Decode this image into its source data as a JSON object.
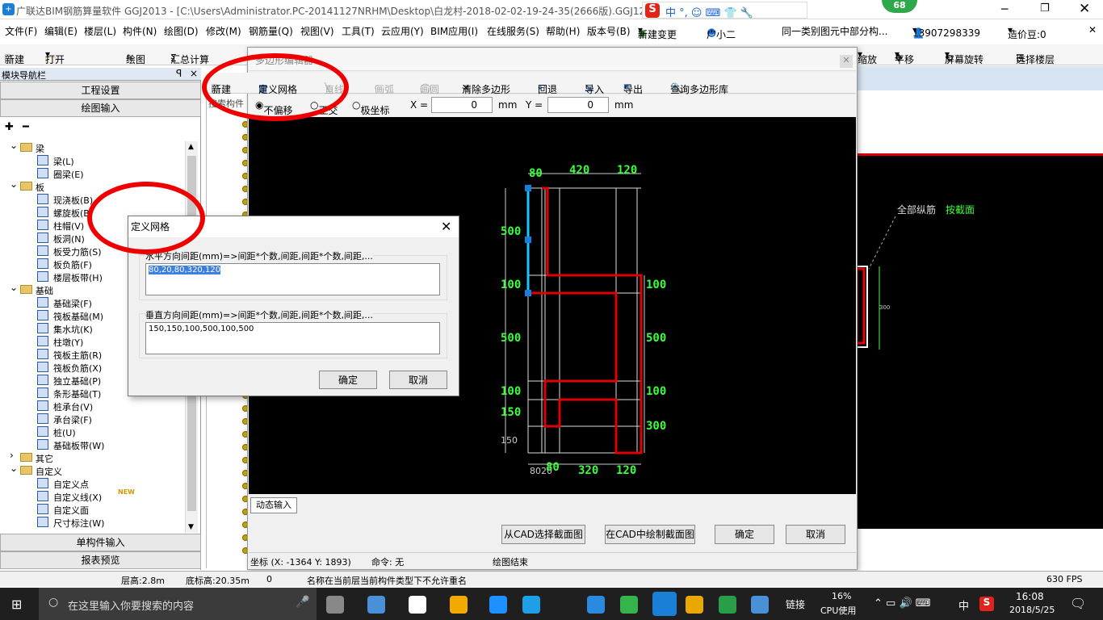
{
  "titlebar": {
    "title": "广联达BIM钢筋算量软件 GGJ2013 - [C:\\Users\\Administrator.PC-20141127NRHM\\Desktop\\白龙村-2018-02-02-19-24-35(2666版).GGJ12]",
    "badge": "68"
  },
  "menu": {
    "file": "文件(F)",
    "edit": "编辑(E)",
    "floor": "楼层(L)",
    "component": "构件(N)",
    "draw": "绘图(D)",
    "modify": "修改(M)",
    "rebar": "钢筋量(Q)",
    "view": "视图(V)",
    "tools": "工具(T)",
    "cloud": "云应用(Y)",
    "bim": "BIM应用(I)",
    "online": "在线服务(S)",
    "help": "帮助(H)",
    "version": "版本号(B)",
    "newchange": "新建变更",
    "xiaoer": "广小二",
    "notice": "同一类别图元中部分构...",
    "phone": "13907298339",
    "beans": "造价豆:0"
  },
  "toolbar": {
    "new": "新建",
    "open": "打开",
    "draw": "绘图",
    "sum": "汇总计算",
    "zoom": "缩放",
    "pan": "平移",
    "rotate": "屏幕旋转",
    "selfloor": "选择楼层"
  },
  "left": {
    "header": "模块导航栏",
    "pin": "ꟼ",
    "close": "×",
    "engsetup": "工程设置",
    "drawinput": "绘图输入",
    "single": "单构件输入",
    "report": "报表预览",
    "tree": [
      {
        "label": "梁",
        "type": "folder"
      },
      {
        "label": "梁(L)",
        "type": "item"
      },
      {
        "label": "圈梁(E)",
        "type": "item"
      },
      {
        "label": "板",
        "type": "folder"
      },
      {
        "label": "现浇板(B)",
        "type": "item"
      },
      {
        "label": "螺旋板(B)",
        "type": "item"
      },
      {
        "label": "柱帽(V)",
        "type": "item"
      },
      {
        "label": "板洞(N)",
        "type": "item"
      },
      {
        "label": "板受力筋(S)",
        "type": "item"
      },
      {
        "label": "板负筋(F)",
        "type": "item"
      },
      {
        "label": "楼层板带(H)",
        "type": "item"
      },
      {
        "label": "基础",
        "type": "folder"
      },
      {
        "label": "基础梁(F)",
        "type": "item"
      },
      {
        "label": "筏板基础(M)",
        "type": "item"
      },
      {
        "label": "集水坑(K)",
        "type": "item"
      },
      {
        "label": "柱墩(Y)",
        "type": "item"
      },
      {
        "label": "筏板主筋(R)",
        "type": "item"
      },
      {
        "label": "筏板负筋(X)",
        "type": "item"
      },
      {
        "label": "独立基础(P)",
        "type": "item"
      },
      {
        "label": "条形基础(T)",
        "type": "item"
      },
      {
        "label": "桩承台(V)",
        "type": "item"
      },
      {
        "label": "承台梁(F)",
        "type": "item"
      },
      {
        "label": "桩(U)",
        "type": "item"
      },
      {
        "label": "基础板带(W)",
        "type": "item"
      },
      {
        "label": "其它",
        "type": "folder"
      },
      {
        "label": "自定义",
        "type": "folder"
      },
      {
        "label": "自定义点",
        "type": "item"
      },
      {
        "label": "自定义线(X)",
        "type": "item"
      },
      {
        "label": "自定义面",
        "type": "item"
      },
      {
        "label": "尺寸标注(W)",
        "type": "item"
      }
    ],
    "newtag": "NEW",
    "midtab": "搜索构件"
  },
  "poly": {
    "title": "多边形编辑器",
    "new": "新建",
    "grid": "定义网格",
    "line": "直线",
    "arc": "画弧",
    "circle": "画圆",
    "clear": "清除多边形",
    "undo": "回退",
    "import": "导入",
    "export": "导出",
    "query": "查询多边形库",
    "nooffset": "不偏移",
    "ortho": "正交",
    "polar": "极坐标",
    "xlabel": "X =",
    "xval": "0",
    "mm1": "mm",
    "ylabel": "Y =",
    "yval": "0",
    "mm2": "mm",
    "dyn": "动态输入",
    "fromcad": "从CAD选择截面图",
    "incad": "在CAD中绘制截面图",
    "ok": "确定",
    "cancel": "取消",
    "coords": "坐标 (X: -1364 Y: 1893)",
    "cmd": "命令: 无",
    "drawend": "绘图结束"
  },
  "cad": {
    "top": [
      "80",
      "420",
      "120"
    ],
    "right": [
      "100",
      "500",
      "100",
      "300"
    ],
    "left": [
      "500",
      "100",
      "500",
      "100",
      "150",
      "150"
    ],
    "bottom": [
      "80",
      "20",
      "80",
      "320",
      "120"
    ]
  },
  "rightpane": {
    "label1": "全部纵筋",
    "label2": "按截面",
    "dim": "300"
  },
  "dialog": {
    "title": "定义网格",
    "hlabel": "水平方向间距(mm)=>间距*个数,间距,间距*个数,间距,...",
    "hvalue": "80,20,80,320,120",
    "vlabel": "垂直方向间距(mm)=>间距*个数,间距,间距*个数,间距,...",
    "vvalue": "150,150,100,500,100,500",
    "ok": "确定",
    "cancel": "取消"
  },
  "status": {
    "floorh": "层高:2.8m",
    "bottomh": "底标高:20.35m",
    "zero": "0",
    "msg": "名称在当前层当前构件类型下不允许重名",
    "fps": "630 FPS"
  },
  "taskbar": {
    "search": "在这里输入你要搜索的内容",
    "link": "链接",
    "cpu": "16%",
    "cpulabel": "CPU使用",
    "ime": "中",
    "time": "16:08",
    "date": "2018/5/25"
  },
  "colors": {
    "red": "#e00000",
    "green": "#3cff3c",
    "cyan": "#19c6ff"
  }
}
